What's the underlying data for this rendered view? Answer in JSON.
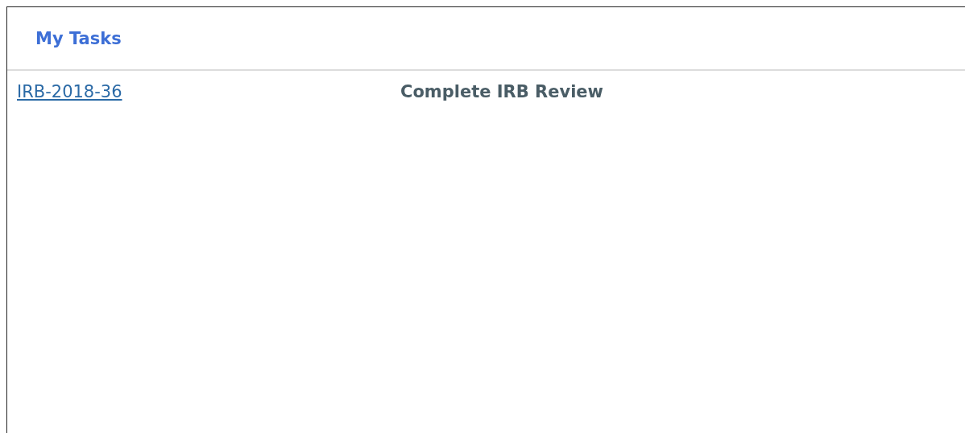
{
  "panel": {
    "title": "My Tasks"
  },
  "tasks": [
    {
      "id": "IRB-2018-36",
      "name": "Complete IRB Review"
    }
  ]
}
